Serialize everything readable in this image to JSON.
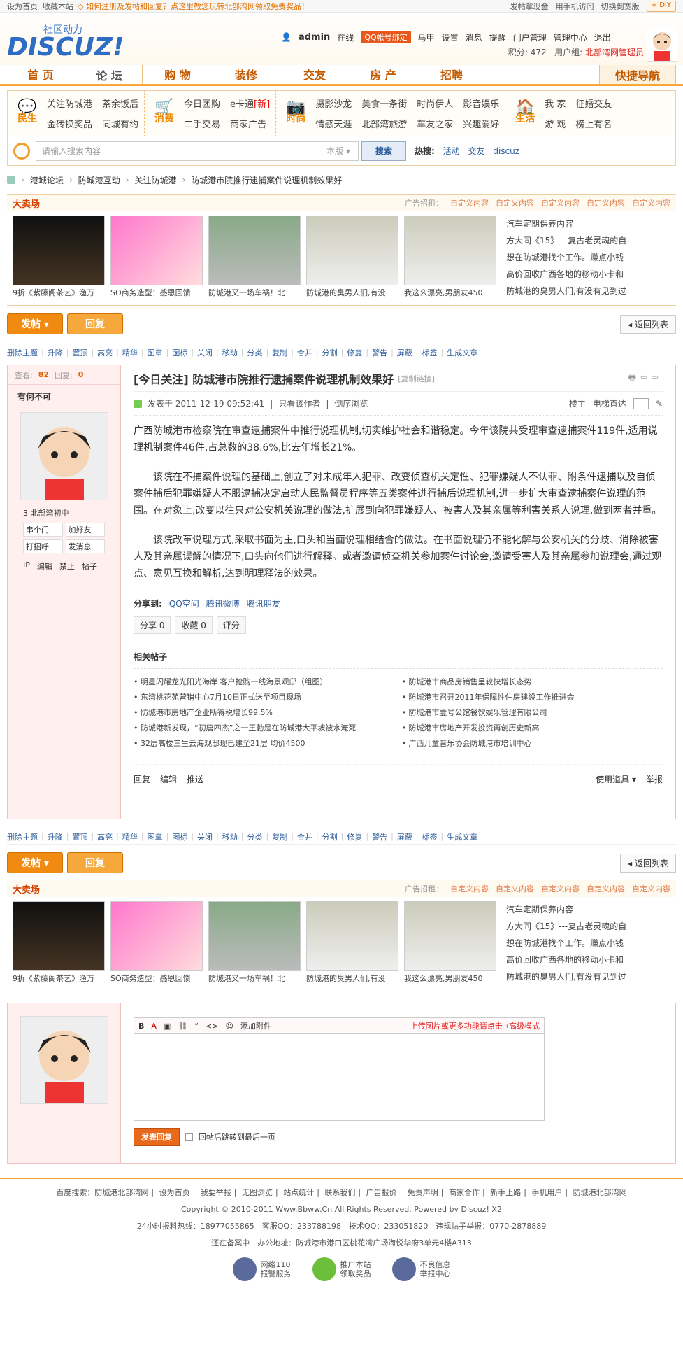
{
  "topbar": {
    "home": "设为首页",
    "fav": "收藏本站",
    "notice": "◇ 如何注册及发帖和回复？点这里教您玩转北部湾网领取免费奖品！",
    "r1": "发帖拿现金",
    "r2": "用手机访问",
    "r3": "切换到宽版",
    "diy": "+ DIY"
  },
  "header": {
    "tag": "社区动力",
    "logo": "DISCUZ!",
    "user": "admin",
    "online": "在线",
    "qqbind": "QQ帐号绑定",
    "horse": "马甲",
    "links": [
      "设置",
      "消息",
      "提醒",
      "门户管理",
      "管理中心",
      "退出"
    ],
    "points": "积分: 472",
    "group_label": "用户组:",
    "group": "北部湾网管理员"
  },
  "mainnav": [
    "首 页",
    "论 坛",
    "购 物",
    "装修",
    "交友",
    "房 产",
    "招聘"
  ],
  "quicknav": "快捷导航",
  "subnav": [
    {
      "icon": "民生",
      "links": [
        "关注防城港",
        "茶余饭后",
        "金砖换奖品",
        "同城有约"
      ],
      "two": true
    },
    {
      "icon": "消费",
      "links": [
        "今日团购",
        "e卡通",
        "二手交易",
        "商家广告"
      ],
      "new": "[新]",
      "two": true
    },
    {
      "icon": "时尚",
      "links": [
        "摄影沙龙",
        "美食一条街",
        "时尚伊人",
        "影音娱乐",
        "情感天涯",
        "北部湾旅游",
        "车友之家",
        "兴趣爱好"
      ]
    },
    {
      "icon": "生活",
      "links": [
        "我 家",
        "征婚交友",
        "游 戏",
        "榜上有名"
      ],
      "two": true
    }
  ],
  "search": {
    "placeholder": "请输入搜索内容",
    "scope": "本版",
    "button": "搜索",
    "hot": "热搜:",
    "hots": [
      "活动",
      "交友",
      "discuz"
    ]
  },
  "crumb": [
    "港城论坛",
    "防城港互动",
    "关注防城港",
    "防城港市院推行逮捕案件说理机制效果好"
  ],
  "ad": {
    "title": "大卖场",
    "intro": "广告招租：",
    "slot": "自定义内容",
    "captions": [
      "9折《紫藤阁茶艺》渔万",
      "SO商务造型：感恩回馈",
      "防城港又一场车祸！北",
      "防城港的臭男人们,有没",
      "我这么漂亮,男朋友450"
    ],
    "list": [
      "汽车定期保养内容",
      "方大同《15》---复古老灵魂的自",
      "想在防城港找个工作。赚点小钱",
      "高价回收广西各地的移动小卡和",
      "防城港的臭男人们,有没有见到过"
    ]
  },
  "buttons": {
    "post": "发帖 ▾",
    "reply": "回复",
    "back": "◂ 返回列表"
  },
  "modbar": [
    "删除主题",
    "升降",
    "置顶",
    "高亮",
    "精华",
    "图章",
    "图标",
    "关闭",
    "移动",
    "分类",
    "复制",
    "合并",
    "分割",
    "修复",
    "警告",
    "屏蔽",
    "标签",
    "生成文章"
  ],
  "post": {
    "views_label": "查看:",
    "views": "82",
    "replies_label": "回复:",
    "replies": "0",
    "author": "有何不可",
    "level_num": "3",
    "level": "北部湾初中",
    "ops": [
      "串个门",
      "加好友",
      "打招呼",
      "发消息"
    ],
    "ops2": [
      "IP",
      "编辑",
      "禁止",
      "帖子"
    ],
    "title": "[今日关注] 防城港市院推行逮捕案件说理机制效果好",
    "copy": "[复制链接]",
    "date": "发表于 2011-12-19 09:52:41",
    "only": "只看该作者",
    "reverse": "倒序浏览",
    "floor": "楼主",
    "jump": "电梯直达",
    "p1": "广西防城港市检察院在审查逮捕案件中推行说理机制,切实维护社会和谐稳定。今年该院共受理审查逮捕案件119件,适用说理机制案件46件,占总数的38.6%,比去年增长21%。",
    "p2": "该院在不捕案件说理的基础上,创立了对未成年人犯罪、改变侦查机关定性、犯罪嫌疑人不认罪、附条件逮捕以及自侦案件捕后犯罪嫌疑人不服逮捕决定启动人民监督员程序等五类案件进行捕后说理机制,进一步扩大审查逮捕案件说理的范围。在对象上,改变以往只对公安机关说理的做法,扩展到向犯罪嫌疑人、被害人及其亲属等利害关系人说理,做到两者并重。",
    "p3": "该院改革说理方式,采取书面为主,口头和当面说理相结合的做法。在书面说理仍不能化解与公安机关的分歧、消除被害人及其亲属误解的情况下,口头向他们进行解释。或者邀请侦查机关参加案件讨论会,邀请受害人及其亲属参加说理会,通过观点、意见互换和解析,达到明理释法的效果。",
    "share_label": "分享到:",
    "shares": [
      "QQ空间",
      "腾讯微博",
      "腾讯朋友"
    ],
    "pbtns": [
      "分享 0",
      "收藏 0",
      "评分"
    ],
    "related_title": "相关帖子",
    "related": [
      "• 明星闪耀龙光阳光海岸 客户抢购一线海景观邸（组图）",
      "• 防城港市商品房销售呈较快增长态势",
      "• 东湾桃花苑营销中心7月10日正式送至项目现场",
      "• 防城港市召开2011年保障性住房建设工作推进会",
      "• 防城港市房地产企业所得税增长99.5%",
      "• 防城港市壹号公馆餐饮娱乐管理有限公司",
      "• 防城港新发现，“初唐四杰”之一王勃是在防城港大平坡被水淹死",
      "• 防城港市房地产开发投资再创历史新高",
      "• 32层高楼三生云海观邸现已建至21层 均价4500",
      "• 广西儿童音乐协会防城港市培训中心"
    ],
    "foot": [
      "回复",
      "编辑",
      "推送"
    ],
    "foot_r": [
      "使用道具 ▾",
      "举报"
    ]
  },
  "editor": {
    "attach": "添加附件",
    "hint": "上传图片或更多功能请点击→高级模式",
    "submit": "发表回复",
    "jump": "回帖后跳转到最后一页"
  },
  "footer": {
    "links": [
      "百度搜索：防城港北部湾网",
      "设为首页",
      "我要举报",
      "无图浏览",
      "站点统计",
      "联系我们",
      "广告报价",
      "免责声明",
      "商家合作",
      "新手上路",
      "手机用户",
      "防城港北部湾网"
    ],
    "copyright": "Copyright © 2010-2011 Www.Bbww.Cn All Rights Reserved. Powered by Discuz! X2",
    "contact": "24小时报料热线：18977055865　客服QQ：233788198　技术QQ：233051820　违规帖子举报：0770-2878889",
    "address": "还在备案中　办公地址：防城港市港口区桃花湾广场海悦华府3单元4楼A313",
    "badges": [
      [
        "网络110",
        "报警服务"
      ],
      [
        "推广本站",
        "领取奖品"
      ],
      [
        "不良信息",
        "举报中心"
      ]
    ]
  }
}
